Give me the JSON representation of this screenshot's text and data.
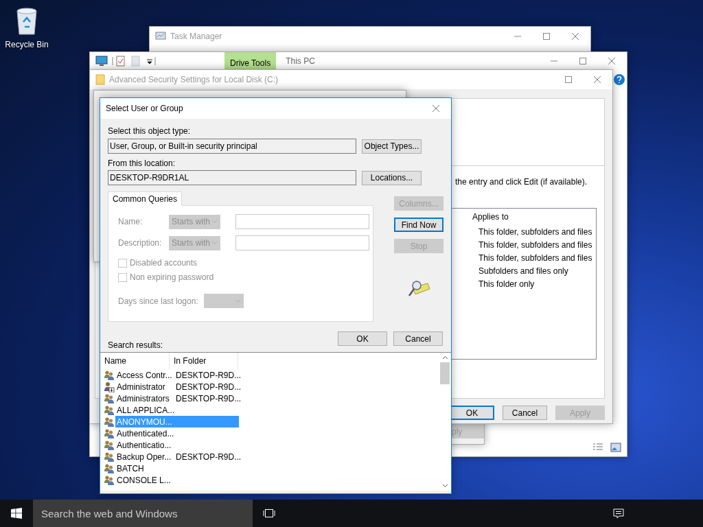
{
  "desktop": {
    "icons": [
      {
        "label": "Recycle Bin"
      }
    ]
  },
  "task_manager": {
    "title": "Task Manager"
  },
  "explorer": {
    "contextual_tab": "Drive Tools",
    "title": "This PC"
  },
  "background_dialog": {
    "button": {
      "label": "ply",
      "disabled": true
    }
  },
  "advanced_security": {
    "title": "Advanced Security Settings for Local Disk (C:)",
    "instruction": "the entry and click Edit (if available).",
    "column": "Applies to",
    "entries": [
      "This folder, subfolders and files",
      "This folder, subfolders and files",
      "This folder, subfolders and files",
      "Subfolders and files only",
      "This folder only"
    ],
    "buttons": [
      {
        "label": "OK",
        "default": true,
        "disabled": false
      },
      {
        "label": "Cancel",
        "default": false,
        "disabled": false
      },
      {
        "label": "Apply",
        "default": false,
        "disabled": true
      }
    ]
  },
  "select_dialog": {
    "title": "Select User or Group",
    "object_type_label": "Select this object type:",
    "object_type": "User, Group, or Built-in security principal",
    "object_types_button": "Object Types...",
    "location_label": "From this location:",
    "location": "DESKTOP-R9DR1AL",
    "locations_button": "Locations...",
    "tabs": [
      {
        "label": "Common Queries",
        "selected": true
      }
    ],
    "queries": [
      {
        "label": "Name:",
        "operator": "Starts with",
        "disabled": true
      },
      {
        "label": "Description:",
        "operator": "Starts with",
        "disabled": true
      }
    ],
    "checkboxes": [
      {
        "label": "Disabled accounts",
        "checked": false,
        "disabled": true
      },
      {
        "label": "Non expiring password",
        "checked": false,
        "disabled": true
      }
    ],
    "days_label": "Days since last logon:",
    "side_buttons": [
      {
        "label": "Columns...",
        "default": false,
        "disabled": true
      },
      {
        "label": "Find Now",
        "default": true,
        "disabled": false
      },
      {
        "label": "Stop",
        "default": false,
        "disabled": true
      }
    ],
    "buttons": [
      {
        "label": "OK",
        "default": false,
        "disabled": false
      },
      {
        "label": "Cancel",
        "default": false,
        "disabled": false
      }
    ],
    "results_label": "Search results:",
    "columns": [
      "Name",
      "In Folder"
    ],
    "rows": [
      {
        "name": "Access Contr...",
        "folder": "DESKTOP-R9D...",
        "kind": "group",
        "selected": false
      },
      {
        "name": "Administrator",
        "folder": "DESKTOP-R9D...",
        "kind": "user",
        "selected": false
      },
      {
        "name": "Administrators",
        "folder": "DESKTOP-R9D...",
        "kind": "group",
        "selected": false
      },
      {
        "name": "ALL APPLICA...",
        "kind": "group",
        "selected": false
      },
      {
        "name": "ANONYMOU...",
        "kind": "group",
        "selected": true
      },
      {
        "name": "Authenticated...",
        "kind": "group",
        "selected": false
      },
      {
        "name": "Authenticatio...",
        "kind": "group",
        "selected": false
      },
      {
        "name": "Backup Oper...",
        "folder": "DESKTOP-R9D...",
        "kind": "group",
        "selected": false
      },
      {
        "name": "BATCH",
        "kind": "group",
        "selected": false
      },
      {
        "name": "CONSOLE L...",
        "kind": "group",
        "selected": false
      }
    ]
  },
  "taskbar": {
    "search_placeholder": "Search the web and Windows"
  }
}
